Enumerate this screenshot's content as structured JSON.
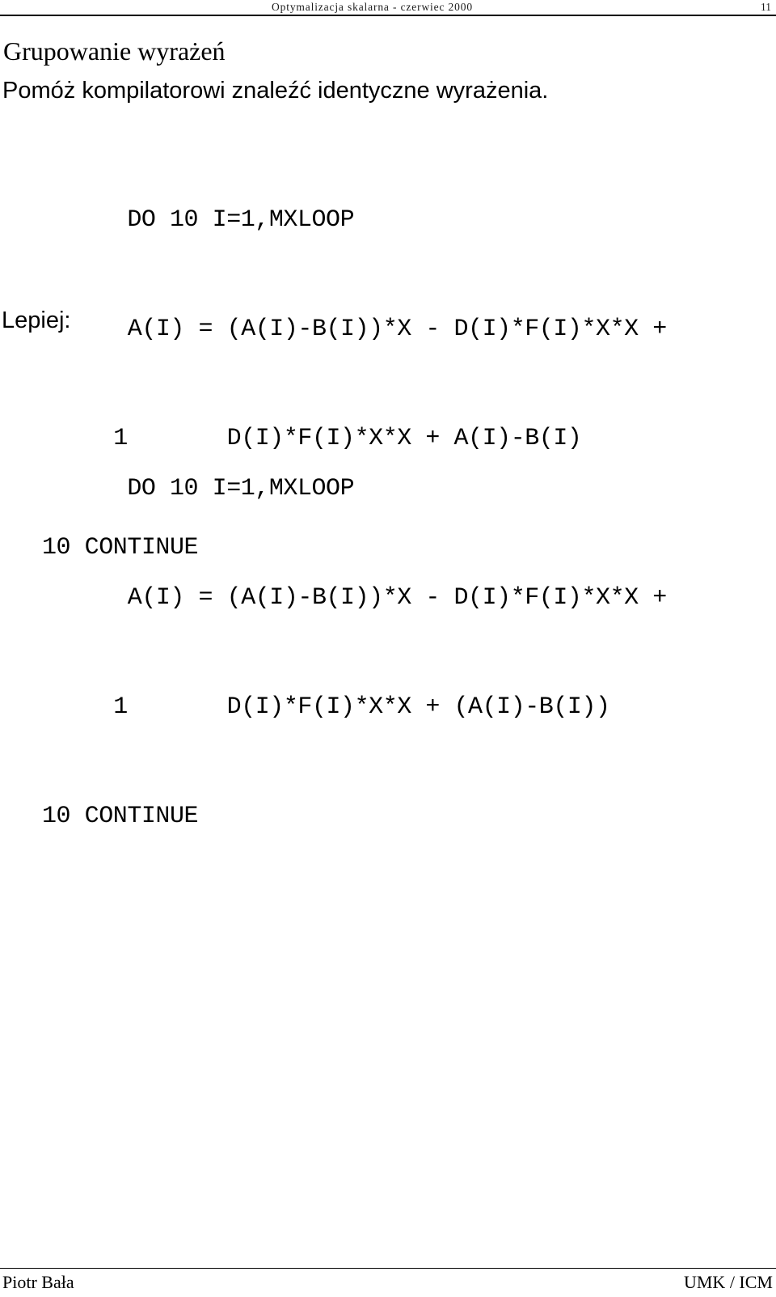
{
  "header": {
    "title": "Optymalizacja skalarna - czerwiec 2000",
    "page_number": "11"
  },
  "slide": {
    "title": "Grupowanie wyrażeń",
    "subtitle": "Pomóż kompilatorowi znaleźć identyczne wyrażenia.",
    "lepiej_label": "Lepiej:"
  },
  "code_blocks": [
    {
      "name": "original-fortran-loop",
      "lines": [
        "      DO 10 I=1,MXLOOP",
        "     A(I) = (A(I)-B(I))*X - D(I)*F(I)*X*X +",
        "    1       D(I)*F(I)*X*X + A(I)-B(I)",
        "10 CONTINUE"
      ]
    },
    {
      "name": "improved-fortran-loop",
      "lines": [
        "      DO 10 I=1,MXLOOP",
        "     A(I) = (A(I)-B(I))*X - D(I)*F(I)*X*X +",
        "    1       D(I)*F(I)*X*X + (A(I)-B(I))",
        "10 CONTINUE"
      ]
    }
  ],
  "footer": {
    "author": "Piotr Bała",
    "affiliation": "UMK / ICM"
  },
  "colors": {
    "text": "#000000",
    "header_text": "#1a1a1a",
    "background": "#ffffff",
    "rule": "#000000"
  }
}
